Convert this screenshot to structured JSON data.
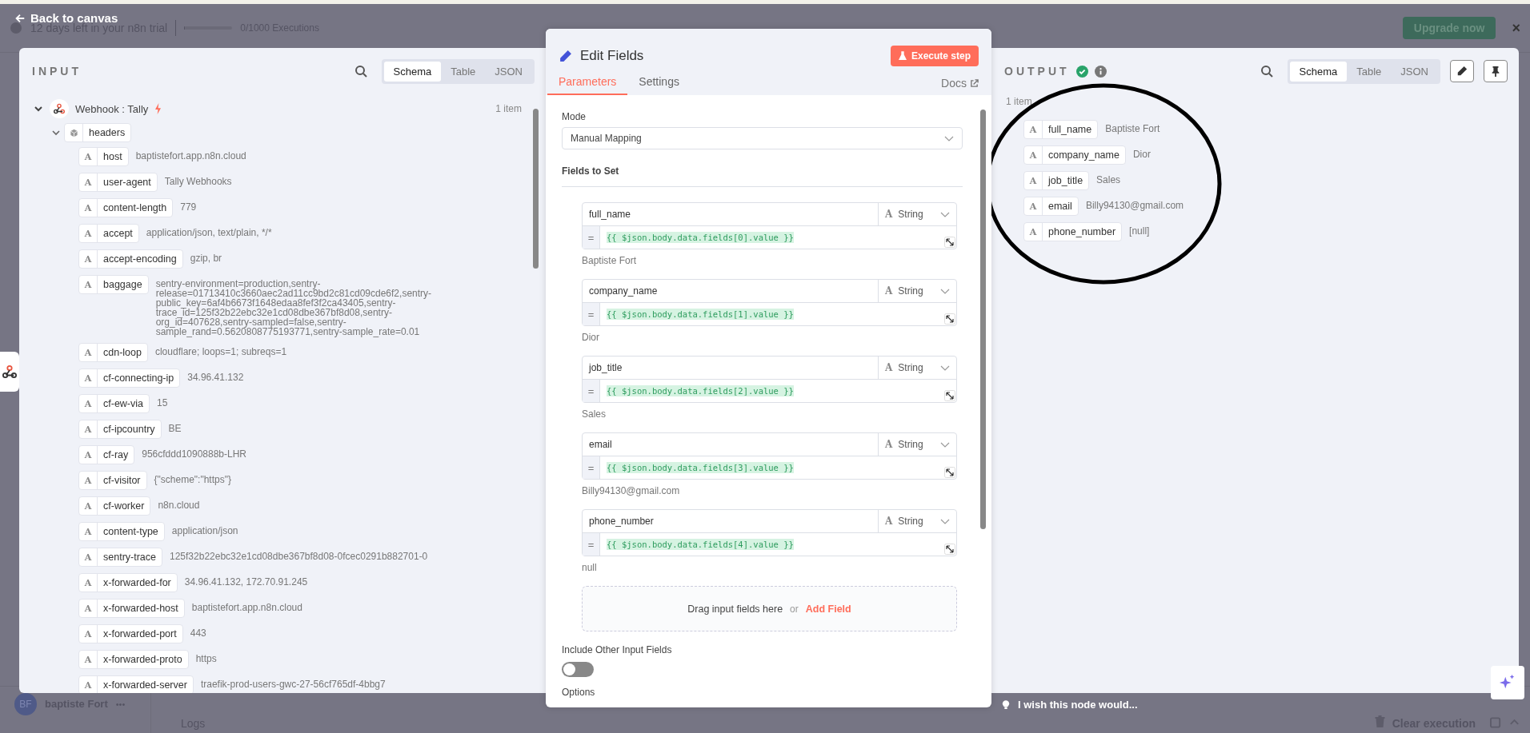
{
  "top_bar": {
    "back_label": "Back to canvas",
    "trial_text": "12 days left in your n8n trial",
    "usage": {
      "text": "0/1000 Executions",
      "level": 0.02
    },
    "upgrade_button": "Upgrade now",
    "close": "×"
  },
  "input": {
    "title": "INPUT",
    "view_tabs": [
      {
        "label": "Schema",
        "selected": true
      },
      {
        "label": "Table",
        "selected": false
      },
      {
        "label": "JSON",
        "selected": false
      }
    ],
    "tree": [
      {
        "label": "Webhook : Tally",
        "count": "1 item",
        "expanded": true,
        "children": [
          {
            "label": "headers",
            "expanded": true,
            "children": [
              {
                "type_glyph": "A",
                "name": "host",
                "value": "baptistefort.app.n8n.cloud"
              },
              {
                "type_glyph": "A",
                "name": "user-agent",
                "value": "Tally Webhooks"
              },
              {
                "type_glyph": "A",
                "name": "content-length",
                "value": "779"
              },
              {
                "type_glyph": "A",
                "name": "accept",
                "value": "application/json, text/plain, */*"
              },
              {
                "type_glyph": "A",
                "name": "accept-encoding",
                "value": "gzip, br"
              },
              {
                "type_glyph": "A",
                "name": "baggage",
                "value": "sentry-environment=production,sentry-release=01713410c3660aec2ad11cc9bd2c81cd09cde6f2,sentry-public_key=6af4b6673f1648edaa8fef3f2ca43405,sentry-trace_id=125f32b22ebc32e1cd08dbe367bf8d08,sentry-org_id=407628,sentry-sampled=false,sentry-sample_rand=0.5620808775193771,sentry-sample_rate=0.01"
              },
              {
                "type_glyph": "A",
                "name": "cdn-loop",
                "value": "cloudflare; loops=1; subreqs=1"
              },
              {
                "type_glyph": "A",
                "name": "cf-connecting-ip",
                "value": "34.96.41.132"
              },
              {
                "type_glyph": "A",
                "name": "cf-ew-via",
                "value": "15"
              },
              {
                "type_glyph": "A",
                "name": "cf-ipcountry",
                "value": "BE"
              },
              {
                "type_glyph": "A",
                "name": "cf-ray",
                "value": "956cfddd1090888b-LHR"
              },
              {
                "type_glyph": "A",
                "name": "cf-visitor",
                "value": "{\"scheme\":\"https\"}"
              },
              {
                "type_glyph": "A",
                "name": "cf-worker",
                "value": "n8n.cloud"
              },
              {
                "type_glyph": "A",
                "name": "content-type",
                "value": "application/json"
              },
              {
                "type_glyph": "A",
                "name": "sentry-trace",
                "value": "125f32b22ebc32e1cd08dbe367bf8d08-0fcec0291b882701-0"
              },
              {
                "type_glyph": "A",
                "name": "x-forwarded-for",
                "value": "34.96.41.132, 172.70.91.245"
              },
              {
                "type_glyph": "A",
                "name": "x-forwarded-host",
                "value": "baptistefort.app.n8n.cloud"
              },
              {
                "type_glyph": "A",
                "name": "x-forwarded-port",
                "value": "443"
              },
              {
                "type_glyph": "A",
                "name": "x-forwarded-proto",
                "value": "https"
              },
              {
                "type_glyph": "A",
                "name": "x-forwarded-server",
                "value": "traefik-prod-users-gwc-27-56cf765df-4bbg7"
              }
            ]
          }
        ]
      }
    ]
  },
  "editor": {
    "title": "Edit Fields",
    "execute_button": "Execute step",
    "tabs": [
      {
        "label": "Parameters",
        "selected": true
      },
      {
        "label": "Settings",
        "selected": false
      }
    ],
    "docs_link": "Docs",
    "mode_label": "Mode",
    "mode_value": "Manual Mapping",
    "fields_heading": "Fields to Set",
    "fields": [
      {
        "name": "full_name",
        "type_glyph": "A",
        "type": "String",
        "prefix": "=",
        "expression": "{{ $json.body.data.fields[0].value }}",
        "result": "Baptiste Fort"
      },
      {
        "name": "company_name",
        "type_glyph": "A",
        "type": "String",
        "prefix": "=",
        "expression": "{{ $json.body.data.fields[1].value }}",
        "result": "Dior"
      },
      {
        "name": "job_title",
        "type_glyph": "A",
        "type": "String",
        "prefix": "=",
        "expression": "{{ $json.body.data.fields[2].value }}",
        "result": "Sales"
      },
      {
        "name": "email",
        "type_glyph": "A",
        "type": "String",
        "prefix": "=",
        "expression": "{{ $json.body.data.fields[3].value }}",
        "result": "Billy94130@gmail.com"
      },
      {
        "name": "phone_number",
        "type_glyph": "A",
        "type": "String",
        "prefix": "=",
        "expression": "{{ $json.body.data.fields[4].value }}",
        "result": "null"
      }
    ],
    "drop_hint": "Drag input fields here",
    "drop_or": "or",
    "add_field": "Add Field",
    "include_other_fields": {
      "label": "Include Other Input Fields",
      "on": false
    },
    "options_label": "Options"
  },
  "output": {
    "title": "OUTPUT",
    "success": true,
    "view_tabs": [
      {
        "label": "Schema",
        "selected": true
      },
      {
        "label": "Table",
        "selected": false
      },
      {
        "label": "JSON",
        "selected": false
      }
    ],
    "count": "1 item",
    "rows": [
      {
        "type_glyph": "A",
        "name": "full_name",
        "value": "Baptiste Fort"
      },
      {
        "type_glyph": "A",
        "name": "company_name",
        "value": "Dior"
      },
      {
        "type_glyph": "A",
        "name": "job_title",
        "value": "Sales"
      },
      {
        "type_glyph": "A",
        "name": "email",
        "value": "Billy94130@gmail.com"
      },
      {
        "type_glyph": "A",
        "name": "phone_number",
        "value": "[null]"
      }
    ]
  },
  "feedback": "I wish this node would...",
  "bottom": {
    "user_initials": "BF",
    "user_name": "baptiste Fort",
    "menu": "•••",
    "logs_label": "Logs",
    "clear_execution": "Clear execution"
  }
}
